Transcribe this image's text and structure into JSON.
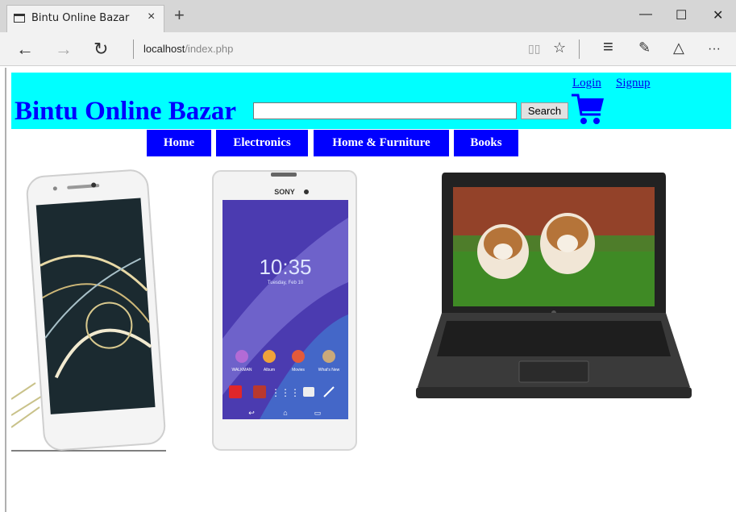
{
  "browser": {
    "tab_title": "Bintu Online Bazar",
    "tab_close": "×",
    "new_tab": "+",
    "address_host": "localhost",
    "address_path": "/index.php",
    "minimize": "—",
    "maximize": "☐",
    "close": "✕",
    "back": "←",
    "forward": "→",
    "refresh": "↻",
    "reading_view": "▯▯",
    "favorite": "☆",
    "hub": "≡",
    "web_note": "✎",
    "share": "△",
    "more": "···"
  },
  "site": {
    "title": "Bintu Online Bazar",
    "search_placeholder": "",
    "search_button": "Search",
    "login": "Login",
    "signup": "Signup",
    "header_color": "#00ffff",
    "accent": "#0000ff"
  },
  "nav": {
    "items": [
      "Home",
      "Electronics",
      "Home & Furniture",
      "Books"
    ]
  },
  "products": [
    {
      "name": "white-smartphone-image",
      "icon": "smartphone"
    },
    {
      "name": "sony-xperia-image",
      "icon": "smartphone"
    },
    {
      "name": "laptop-image",
      "icon": "laptop"
    }
  ],
  "phone_screen": {
    "brand": "SONY",
    "time": "10:35",
    "date": "Tuesday, Feb 10",
    "apps": [
      "WALKMAN",
      "Album",
      "Movies",
      "What's New"
    ]
  }
}
